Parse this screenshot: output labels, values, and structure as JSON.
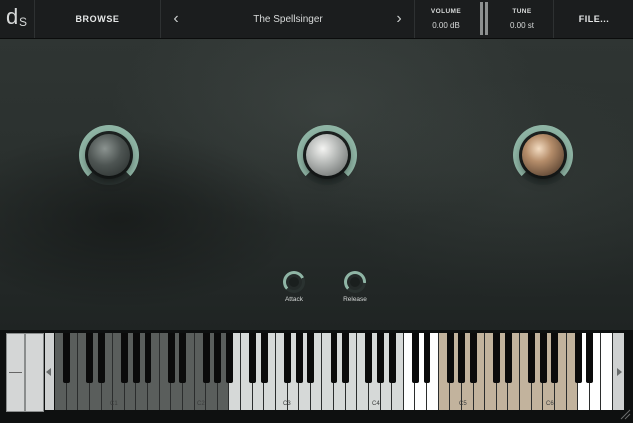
{
  "topbar": {
    "logo": {
      "main": "d",
      "sub": "S"
    },
    "browse_label": "BROWSE",
    "prev_icon": "‹",
    "preset_name": "The Spellsinger",
    "next_icon": "›",
    "volume": {
      "label": "VOLUME",
      "value": "0.00 dB"
    },
    "tune": {
      "label": "TUNE",
      "value": "0.00 st"
    },
    "file_label": "FILE..."
  },
  "controls": {
    "attack_label": "Attack",
    "release_label": "Release"
  },
  "keyboard": {
    "octave_labels": [
      "C1",
      "C2",
      "C3",
      "C4",
      "C5",
      "C6"
    ],
    "colors": {
      "dark_zone": "#5a5e5c",
      "light_zone": "#d6d9d8",
      "white": "#ffffff",
      "tan_zone": "#c2b39d",
      "black": "#0b0b0b"
    }
  },
  "colors": {
    "accent": "#8fb5a5",
    "topbar_bg": "#1b1d1e",
    "panel_bg": "#2c3230"
  }
}
